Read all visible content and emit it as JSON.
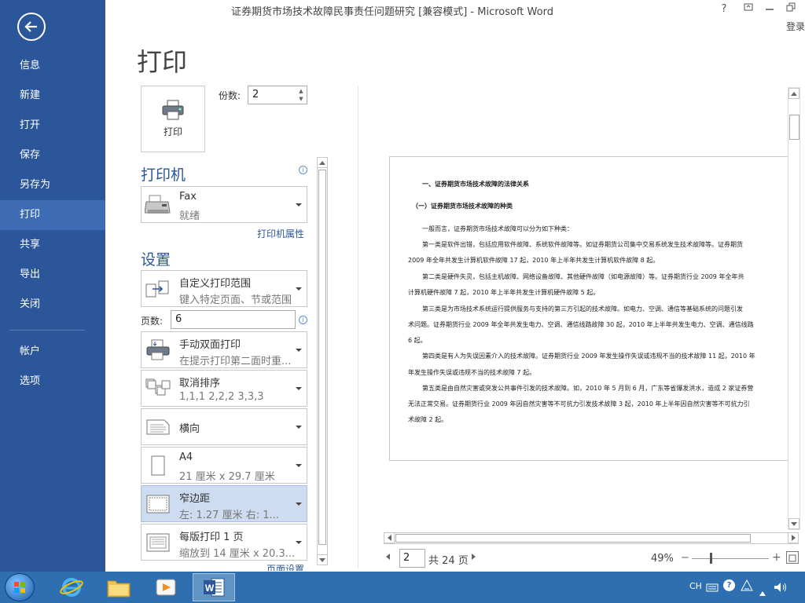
{
  "window": {
    "title": "证券期货市场技术故障民事责任问题研究 [兼容模式] - Microsoft Word",
    "help": "?",
    "login": "登录"
  },
  "sidebar": {
    "items": [
      {
        "label": "信息"
      },
      {
        "label": "新建"
      },
      {
        "label": "打开"
      },
      {
        "label": "保存"
      },
      {
        "label": "另存为"
      },
      {
        "label": "打印"
      },
      {
        "label": "共享"
      },
      {
        "label": "导出"
      },
      {
        "label": "关闭"
      },
      {
        "label": "帐户"
      },
      {
        "label": "选项"
      }
    ],
    "active": "打印"
  },
  "print": {
    "title": "打印",
    "button_label": "打印",
    "copies_label": "份数:",
    "copies_value": "2",
    "printer_heading": "打印机",
    "printer": {
      "name": "Fax",
      "status": "就绪"
    },
    "printer_properties": "打印机属性",
    "settings_heading": "设置",
    "range": {
      "title": "自定义打印范围",
      "sub": "键入特定页面、节或范围"
    },
    "pages_label": "页数:",
    "pages_value": "6",
    "duplex": {
      "title": "手动双面打印",
      "sub": "在提示打印第二面时重..."
    },
    "collate": {
      "title": "取消排序",
      "sub": "1,1,1    2,2,2    3,3,3"
    },
    "orientation": {
      "title": "横向"
    },
    "paper": {
      "title": "A4",
      "sub": "21 厘米 x 29.7 厘米"
    },
    "margins": {
      "title": "窄边距",
      "sub": "左: 1.27 厘米    右: 1..."
    },
    "pages_per_sheet": {
      "title": "每版打印 1 页",
      "sub": "缩放到 14 厘米 x 20.3..."
    },
    "page_setup": "页面设置"
  },
  "preview": {
    "lines": [
      "一、证券期货市场技术故障的法律关系",
      "（一）证券期货市场技术故障的种类",
      "一般而言，证券期货市场技术故障可以分为如下种类：",
      "第一类是软件出错，包括应用软件故障、系统软件故障等。如证券期货公司集中交易系统发生技术故障等。证券期货",
      "2009 年全年共发生计算机软件故障 17 起，2010 年上半年共发生计算机软件故障 8 起。",
      "第二类是硬件失灵，包括主机故障、网络设备故障、其他硬件故障（如电源故障）等。证券期货行业 2009 年全年共",
      "计算机硬件故障 7 起，2010 年上半年共发生计算机硬件故障 5 起。",
      "第三类是为市场技术系统运行提供服务与支持的第三方引起的技术故障。如电力、空调、通信等基础系统的问题引发",
      "术问题。证券期货行业 2009 年全年共发生电力、空调、通信线路故障 30 起，2010 年上半年共发生电力、空调、通信线路",
      "6 起。",
      "第四类是有人为失误因素介入的技术故障。证券期货行业 2009 年发生操作失误或违规不当的技术故障 11 起，2010 年",
      "年发生操作失误或违规不当的技术故障 7 起。",
      "第五类是由自然灾害或突发公共事件引发的技术故障。如，2010 年 5 月到 6 月，广东等省爆发洪水，造成 2 家证券营",
      "无法正常交易。证券期货行业 2009 年因自然灾害等不可抗力引发技术故障 3 起，2010 年上半年因自然灾害等不可抗力引",
      "术故障 2 起。"
    ],
    "current_page": "2",
    "total_pages": "共 24 页",
    "zoom": "49%"
  },
  "taskbar": {
    "lang": "CH"
  }
}
